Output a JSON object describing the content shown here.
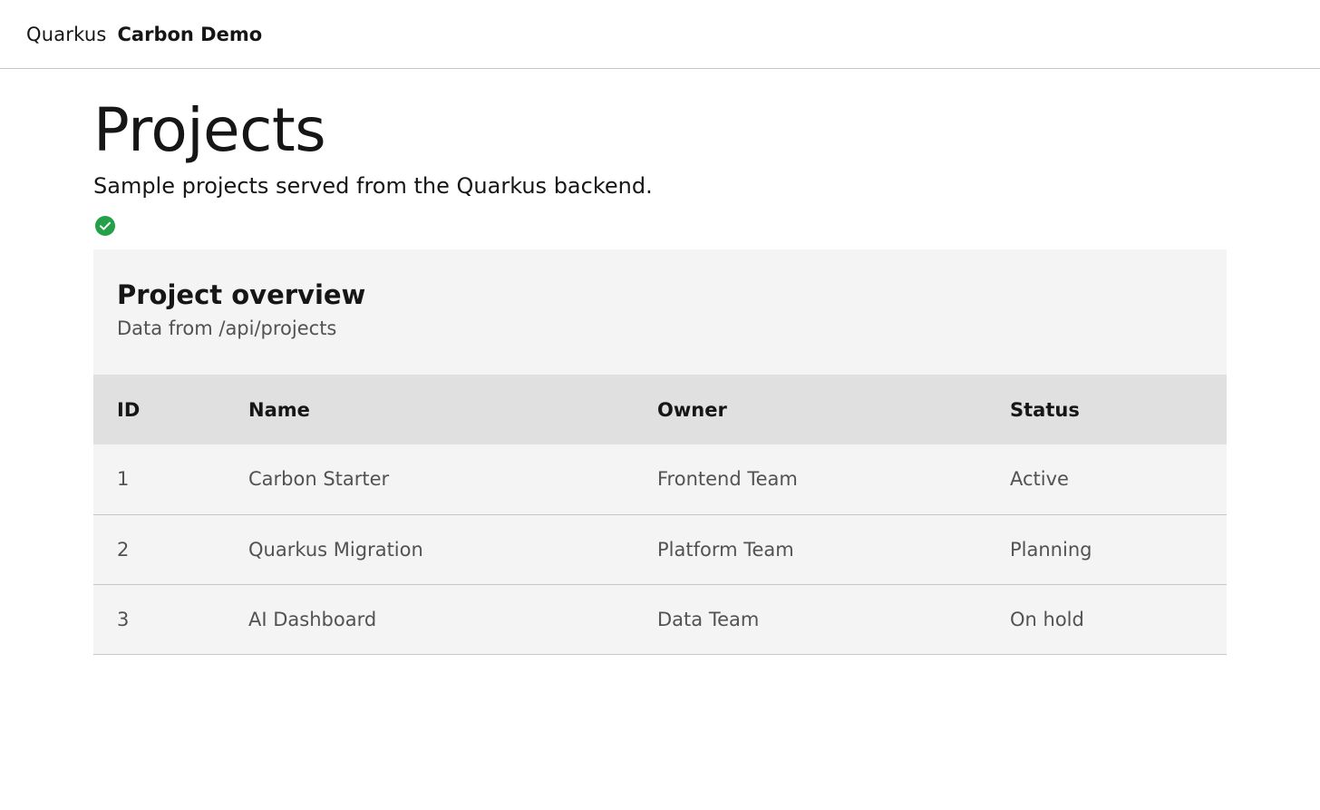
{
  "header": {
    "prefix": "Quarkus",
    "product": "Carbon Demo"
  },
  "page": {
    "title": "Projects",
    "subtitle": "Sample projects served from the Quarkus backend.",
    "status_icon": "checkmark-filled-icon",
    "status_color": "#24a148"
  },
  "table": {
    "title": "Project overview",
    "description": "Data from /api/projects",
    "columns": [
      "ID",
      "Name",
      "Owner",
      "Status"
    ],
    "rows": [
      {
        "id": "1",
        "name": "Carbon Starter",
        "owner": "Frontend Team",
        "status": "Active"
      },
      {
        "id": "2",
        "name": "Quarkus Migration",
        "owner": "Platform Team",
        "status": "Planning"
      },
      {
        "id": "3",
        "name": "AI Dashboard",
        "owner": "Data Team",
        "status": "On hold"
      }
    ]
  }
}
